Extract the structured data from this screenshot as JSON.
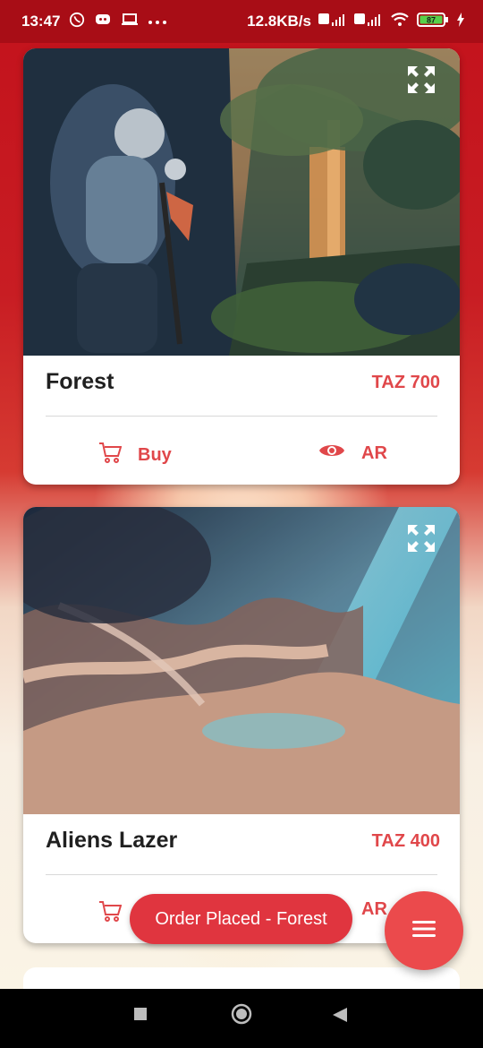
{
  "status_bar": {
    "time": "13:47",
    "notification_icons": [
      "whatsapp-icon",
      "discord-icon",
      "monitor-icon",
      "more-dots-icon"
    ],
    "net_speed": "12.8KB/s",
    "battery": "87"
  },
  "cards": [
    {
      "title": "Forest",
      "price": "TAZ 700",
      "buy_label": "Buy",
      "ar_label": "AR"
    },
    {
      "title": "Aliens Lazer",
      "price": "TAZ 400",
      "buy_label": "",
      "ar_label": "AR"
    }
  ],
  "toast": {
    "text": "Order Placed - Forest"
  },
  "colors": {
    "accent": "#e0474a",
    "status_bar": "#a80d16",
    "toast": "#e0353f",
    "fab": "#eb4a4c"
  },
  "icons": {
    "expand": "expand-arrows-icon",
    "buy": "cart-icon",
    "ar": "eye-icon",
    "fab": "menu-icon"
  }
}
